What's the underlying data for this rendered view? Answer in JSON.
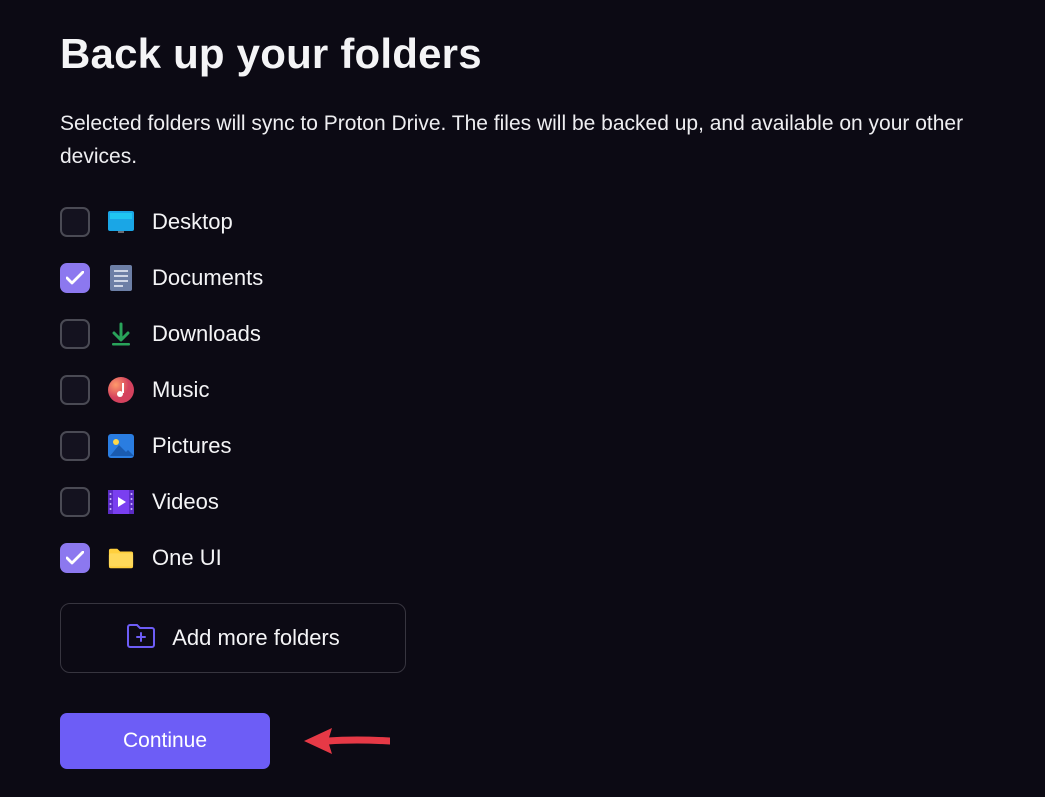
{
  "title": "Back up your folders",
  "subtitle": "Selected folders will sync to Proton Drive. The files will be backed up, and available on your other devices.",
  "folders": [
    {
      "label": "Desktop",
      "checked": false,
      "icon": "desktop-icon"
    },
    {
      "label": "Documents",
      "checked": true,
      "icon": "documents-icon"
    },
    {
      "label": "Downloads",
      "checked": false,
      "icon": "downloads-icon"
    },
    {
      "label": "Music",
      "checked": false,
      "icon": "music-icon"
    },
    {
      "label": "Pictures",
      "checked": false,
      "icon": "pictures-icon"
    },
    {
      "label": "Videos",
      "checked": false,
      "icon": "videos-icon"
    },
    {
      "label": "One UI",
      "checked": true,
      "icon": "folder-icon"
    }
  ],
  "add_more_label": "Add more folders",
  "continue_label": "Continue",
  "colors": {
    "accent": "#6d5df6",
    "checkbox_checked": "#8c78ef",
    "annotation_arrow": "#e63946"
  }
}
